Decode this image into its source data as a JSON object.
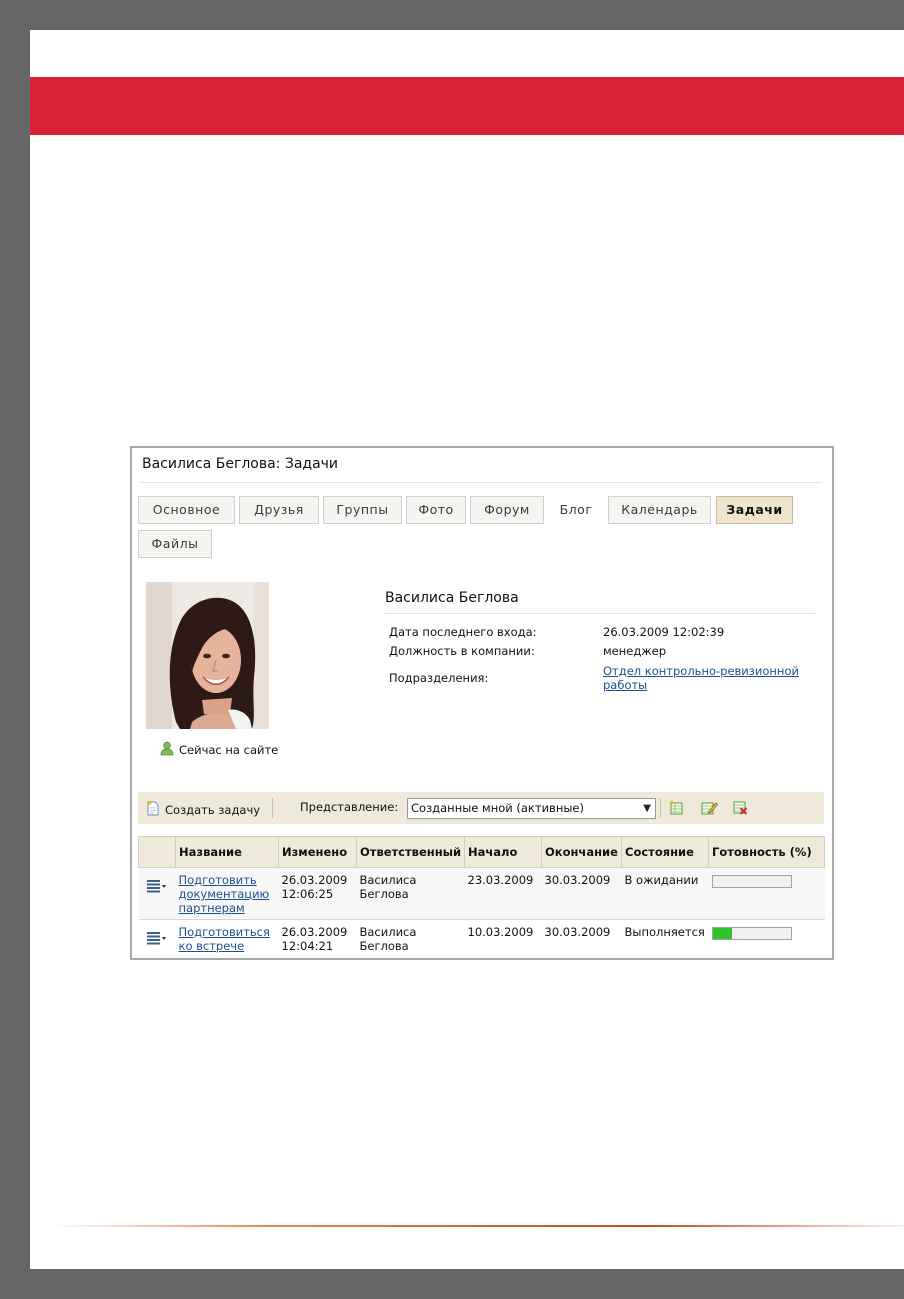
{
  "profile_page": {
    "title": "Василиса Беглова: Задачи",
    "tabs": [
      {
        "label": "Основное"
      },
      {
        "label": "Друзья"
      },
      {
        "label": "Группы"
      },
      {
        "label": "Фото"
      },
      {
        "label": "Форум"
      },
      {
        "label": "Блог"
      },
      {
        "label": "Календарь"
      },
      {
        "label": "Задачи",
        "active": true
      },
      {
        "label": "Файлы"
      }
    ],
    "online_status": "Сейчас на сайте",
    "person": {
      "name": "Василиса Беглова",
      "fields": [
        {
          "label": "Дата последнего входа:",
          "value": "26.03.2009 12:02:39"
        },
        {
          "label": "Должность в компании:",
          "value": "менеджер"
        },
        {
          "label": "Подразделения:",
          "value": "Отдел контрольно-ревизионной работы",
          "link": true
        }
      ]
    },
    "toolbar": {
      "create_label": "Создать задачу",
      "view_label": "Представление:",
      "view_selected": "Созданные мной (активные)"
    },
    "tasks_table": {
      "columns": [
        "Название",
        "Изменено",
        "Ответственный",
        "Начало",
        "Окончание",
        "Состояние",
        "Готовность (%)"
      ],
      "rows": [
        {
          "name": "Подготовить документацию партнерам",
          "modified": "26.03.2009 12:06:25",
          "responsible": "Василиса Беглова",
          "start": "23.03.2009",
          "end": "30.03.2009",
          "status": "В ожидании",
          "progress_percent": 0
        },
        {
          "name": "Подготовиться ко встрече",
          "modified": "26.03.2009 12:04:21",
          "responsible": "Василиса Беглова",
          "start": "10.03.2009",
          "end": "30.03.2009",
          "status": "Выполняется",
          "progress_percent": 25
        }
      ]
    }
  },
  "colors": {
    "frame": "#666666",
    "brand_band": "#da2236",
    "active_tab": "#efe4cc",
    "toolbar": "#efe9d9",
    "progress_fill": "#2fc52a",
    "link": "#1f4f8f"
  },
  "icons": [
    "task-menu-icon",
    "create-task-icon",
    "add-view-icon",
    "edit-view-icon",
    "delete-view-icon",
    "online-user-icon"
  ]
}
